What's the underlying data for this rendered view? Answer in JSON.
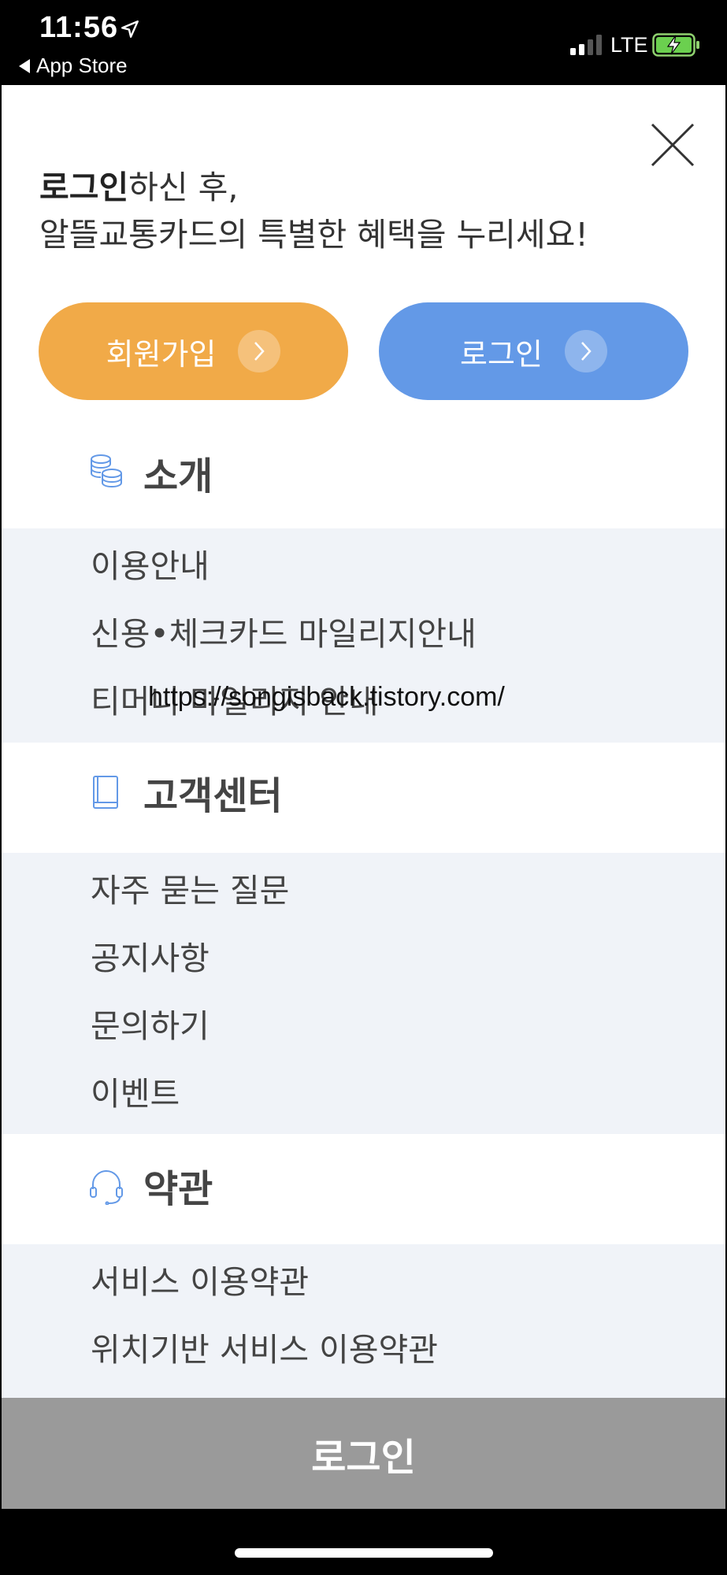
{
  "status_bar": {
    "time": "11:56",
    "back_label": "App Store",
    "network": "LTE"
  },
  "intro": {
    "line1_bold": "로그인",
    "line1_rest": "하신 후,",
    "line2": "알뜰교통카드의 특별한 혜택을 누리세요!"
  },
  "buttons": {
    "signup": "회원가입",
    "login": "로그인"
  },
  "sections": [
    {
      "title": "소개",
      "icon": "coins-icon",
      "items": [
        "이용안내",
        "신용•체크카드 마일리지안내",
        "티머니 마일리지 안내"
      ]
    },
    {
      "title": "고객센터",
      "icon": "book-icon",
      "items": [
        "자주 묻는 질문",
        "공지사항",
        "문의하기",
        "이벤트"
      ]
    },
    {
      "title": "약관",
      "icon": "headset-icon",
      "items": [
        "서비스 이용약관",
        "위치기반 서비스 이용약관"
      ]
    }
  ],
  "watermark": "https://songisback.tistory.com/",
  "bottom_button": "로그인",
  "colors": {
    "signup": "#F1AA48",
    "login": "#6399E7",
    "menu_bg": "#F0F3F8",
    "bottom_bar": "#9A9A9A"
  }
}
